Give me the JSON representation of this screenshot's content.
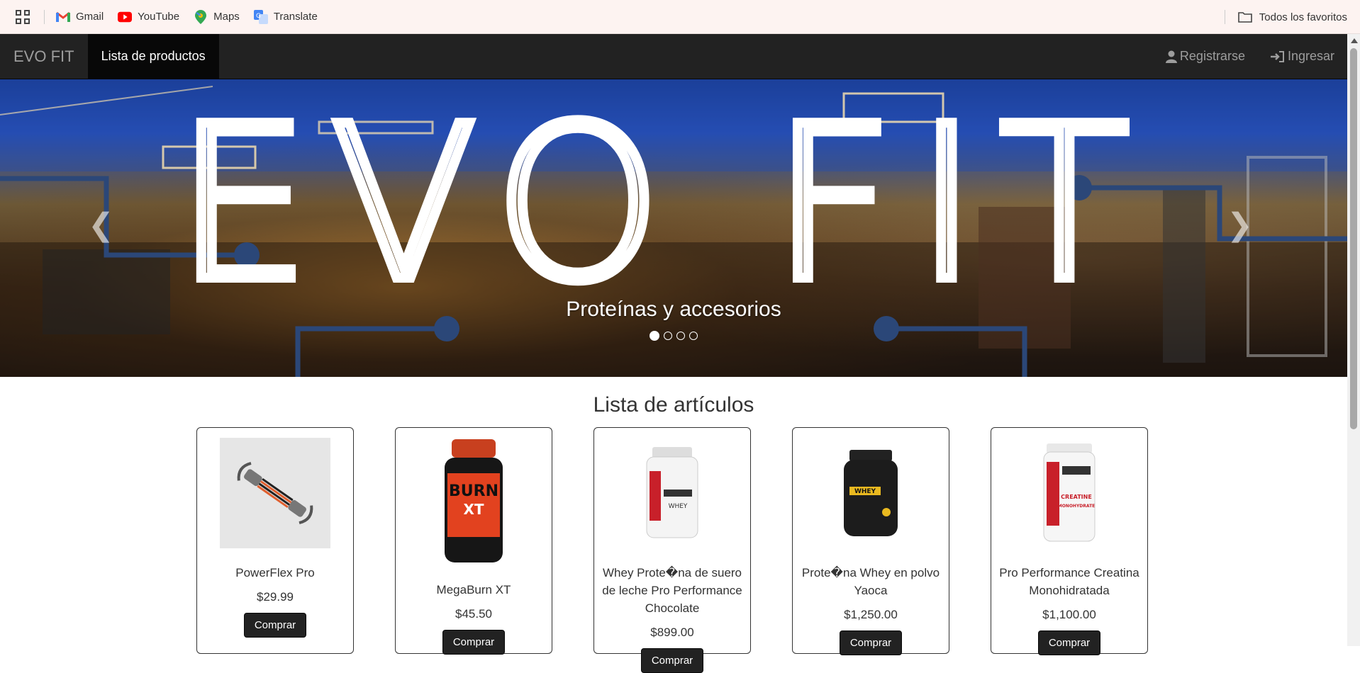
{
  "bookmarks": {
    "items": [
      {
        "label": "Gmail",
        "icon": "gmail-icon"
      },
      {
        "label": "YouTube",
        "icon": "youtube-icon"
      },
      {
        "label": "Maps",
        "icon": "maps-icon"
      },
      {
        "label": "Translate",
        "icon": "translate-icon"
      }
    ],
    "all_bookmarks": "Todos los favoritos"
  },
  "navbar": {
    "brand": "EVO FIT",
    "active_link": "Lista de productos",
    "register": "Registrarse",
    "login": "Ingresar"
  },
  "carousel": {
    "headline": "EVO FIT",
    "caption": "Proteínas y accesorios",
    "indicator_count": 4,
    "active_indicator": 1,
    "prev_icon": "chevron-left-icon",
    "next_icon": "chevron-right-icon"
  },
  "products_section": {
    "title": "Lista de artículos",
    "button_label": "Comprar",
    "products": [
      {
        "name": "PowerFlex Pro",
        "price": "$29.99",
        "image": "chest-expander"
      },
      {
        "name": "MegaBurn XT",
        "price": "$45.50",
        "image": "burn-xt-bottle"
      },
      {
        "name": "Whey Prote�na de suero de leche Pro Performance Chocolate",
        "price": "$899.00",
        "image": "pro-whey-tub"
      },
      {
        "name": "Prote�na Whey en polvo Yaoca",
        "price": "$1,250.00",
        "image": "black-whey-tub"
      },
      {
        "name": "Pro Performance Creatina Monohidratada",
        "price": "$1,100.00",
        "image": "creatine-tub"
      }
    ]
  },
  "colors": {
    "navbar_bg": "#222222",
    "navbar_active_bg": "#080808",
    "button_bg": "#222222",
    "bookmarks_bg": "#fdf3f1"
  }
}
